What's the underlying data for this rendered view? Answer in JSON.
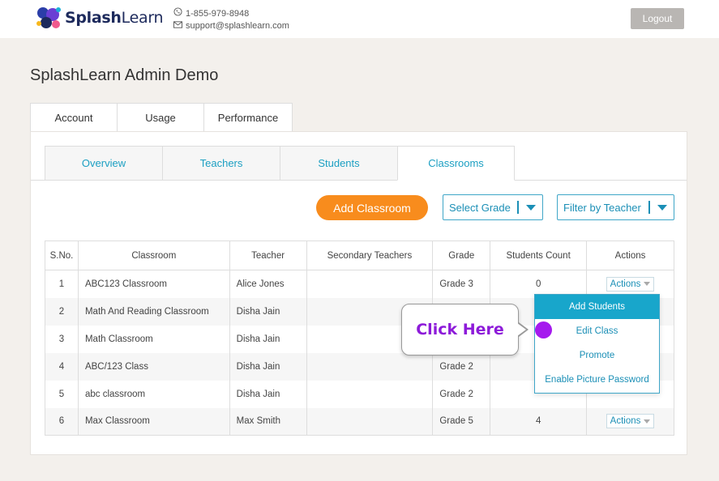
{
  "header": {
    "brand_part1": "Splash",
    "brand_part2": "Learn",
    "phone": "1-855-979-8948",
    "email": "support@splashlearn.com",
    "logout_label": "Logout"
  },
  "page_title": "SplashLearn Admin Demo",
  "main_tabs": [
    {
      "label": "Account"
    },
    {
      "label": "Usage"
    },
    {
      "label": "Performance"
    }
  ],
  "sub_tabs": [
    {
      "label": "Overview"
    },
    {
      "label": "Teachers"
    },
    {
      "label": "Students"
    },
    {
      "label": "Classrooms",
      "active": true
    }
  ],
  "toolbar": {
    "add_classroom_label": "Add Classroom",
    "grade_select": "Select Grade",
    "teacher_select": "Filter by Teacher"
  },
  "table": {
    "headers": [
      "S.No.",
      "Classroom",
      "Teacher",
      "Secondary Teachers",
      "Grade",
      "Students Count",
      "Actions"
    ],
    "rows": [
      {
        "sno": "1",
        "classroom": "ABC123 Classroom",
        "teacher": "Alice Jones",
        "secondary": "",
        "grade": "Grade 3",
        "count": "0",
        "action": "Actions"
      },
      {
        "sno": "2",
        "classroom": "Math And Reading Classroom",
        "teacher": "Disha Jain",
        "secondary": "",
        "grade": "",
        "count": "",
        "action": ""
      },
      {
        "sno": "3",
        "classroom": "Math Classroom",
        "teacher": "Disha Jain",
        "secondary": "",
        "grade": "",
        "count": "",
        "action": ""
      },
      {
        "sno": "4",
        "classroom": "ABC/123 Class",
        "teacher": "Disha Jain",
        "secondary": "",
        "grade": "Grade 2",
        "count": "",
        "action": ""
      },
      {
        "sno": "5",
        "classroom": "abc classroom",
        "teacher": "Disha Jain",
        "secondary": "",
        "grade": "Grade 2",
        "count": "",
        "action": ""
      },
      {
        "sno": "6",
        "classroom": "Max Classroom",
        "teacher": "Max Smith",
        "secondary": "",
        "grade": "Grade 5",
        "count": "4",
        "action": "Actions"
      }
    ]
  },
  "actions_menu": {
    "items": [
      "Add Students",
      "Edit Class",
      "Promote",
      "Enable Picture Password"
    ]
  },
  "callout": {
    "text": "Click Here"
  },
  "colors": {
    "accent_blue": "#18a6cb",
    "orange": "#f88c1d",
    "callout_purple": "#8d1bd9"
  }
}
